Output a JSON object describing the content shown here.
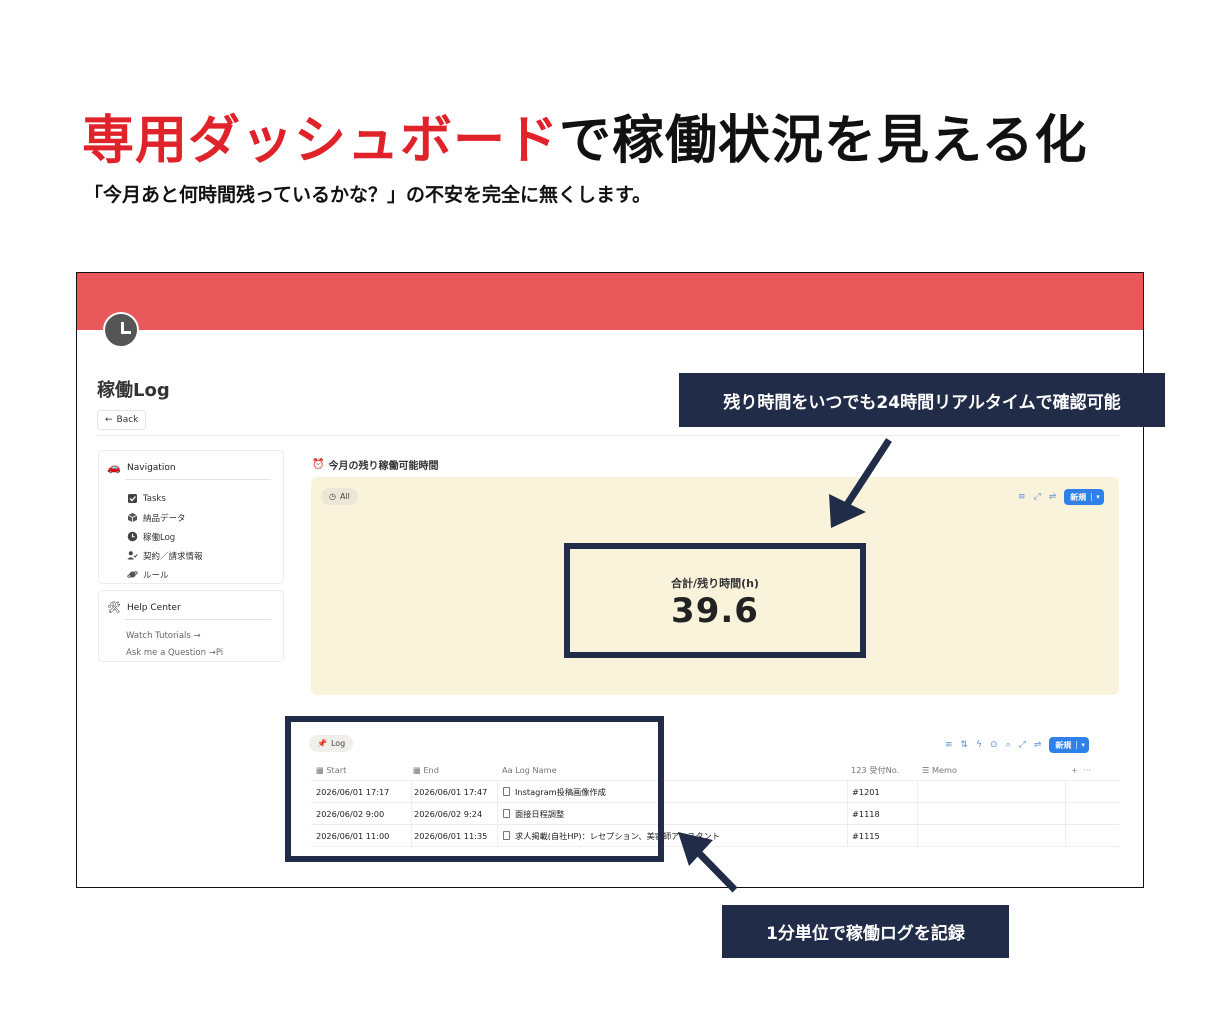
{
  "headline": {
    "red": "専用ダッシュボード",
    "black": "で稼働状況を見える化"
  },
  "subline": "「今月あと何時間残っているかな？」の不安を完全に無くします。",
  "page": {
    "title": "稼働Log",
    "back": "Back"
  },
  "navigation": {
    "heading": "Navigation",
    "items": [
      {
        "label": "Tasks",
        "icon": "checkbox-icon"
      },
      {
        "label": "納品データ",
        "icon": "box-icon"
      },
      {
        "label": "稼働Log",
        "icon": "clock-icon"
      },
      {
        "label": "契約／請求情報",
        "icon": "user-check-icon"
      },
      {
        "label": "ルール",
        "icon": "planet-icon"
      }
    ]
  },
  "help": {
    "heading": "Help Center",
    "items": [
      "Watch Tutorials →",
      "Ask me a Question →Pi"
    ]
  },
  "summary": {
    "title": "今月の残り稼働可能時間",
    "view_chip": "All",
    "new_button": "新規",
    "metric_label": "合計/残り時間(h)",
    "metric_value": "39.6"
  },
  "log": {
    "view_chip": "Log",
    "new_button": "新規",
    "columns": [
      "Start",
      "End",
      "Log Name",
      "受付No.",
      "Memo"
    ],
    "col_prefixes": {
      "log_name": "Aa",
      "number": "123"
    },
    "rows": [
      {
        "start": "2026/06/01 17:17",
        "end": "2026/06/01 17:47",
        "name": "Instagram投稿画像作成",
        "no": "#1201",
        "memo": ""
      },
      {
        "start": "2026/06/02 9:00",
        "end": "2026/06/02 9:24",
        "name": "面接日程調整",
        "no": "#1118",
        "memo": ""
      },
      {
        "start": "2026/06/01 11:00",
        "end": "2026/06/01 11:35",
        "name": "求人掲載(自社HP)：レセプション、美容師アシスタント",
        "no": "#1115",
        "memo": ""
      }
    ]
  },
  "callouts": {
    "top": "残り時間をいつでも24時間リアルタイムで確認可能",
    "bottom": "1分単位で稼働ログを記録"
  },
  "colors": {
    "accent_red": "#e0232a",
    "cover": "#e9585a",
    "navy": "#212c48",
    "panel": "#f9f3dc",
    "button_blue": "#2f80e8"
  }
}
